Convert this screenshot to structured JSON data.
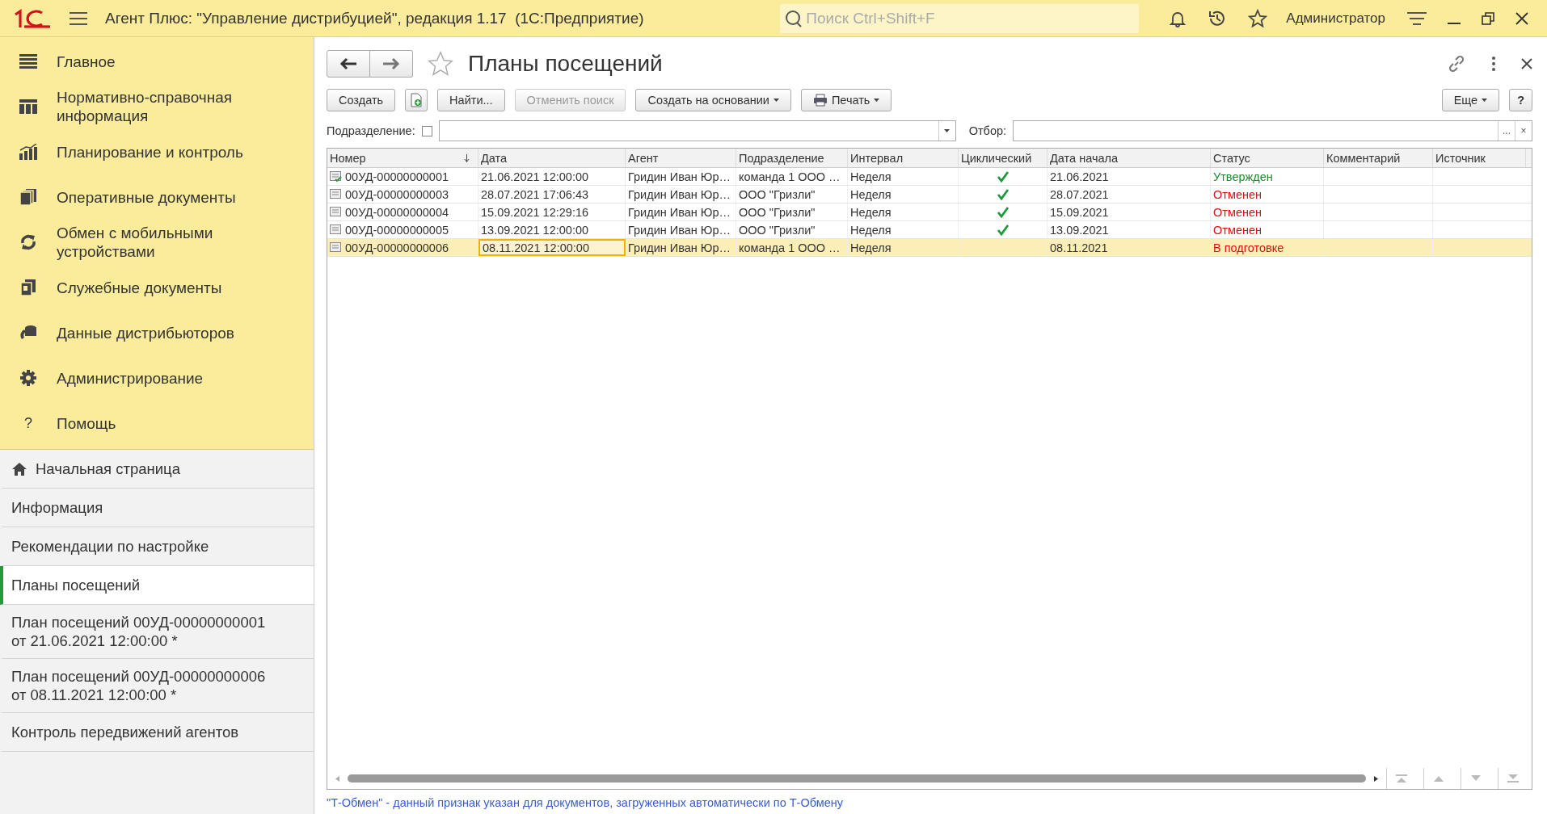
{
  "window": {
    "title": "Агент Плюс: \"Управление дистрибуцией\", редакция 1.17  (1С:Предприятие)",
    "search": {
      "placeholder": "Поиск Ctrl+Shift+F"
    },
    "user": "Администратор"
  },
  "sections": [
    {
      "label": "Главное"
    },
    {
      "label": "Нормативно-справочная информация"
    },
    {
      "label": "Планирование и контроль"
    },
    {
      "label": "Оперативные документы"
    },
    {
      "label": "Обмен с мобильными устройствами"
    },
    {
      "label": "Служебные документы"
    },
    {
      "label": "Данные дистрибьюторов"
    },
    {
      "label": "Администрирование"
    },
    {
      "label": "Помощь",
      "glyph": "?"
    }
  ],
  "open_windows": [
    {
      "label": "Начальная страница",
      "kind": "home",
      "selected": false
    },
    {
      "label": "Информация",
      "kind": "page",
      "selected": false
    },
    {
      "label": "Рекомендации по настройке",
      "kind": "page",
      "selected": false
    },
    {
      "label": "Планы посещений",
      "kind": "page",
      "selected": true
    },
    {
      "label": "План посещений 00УД-00000000001 от 21.06.2021 12:00:00 *",
      "kind": "page",
      "selected": false
    },
    {
      "label": "План посещений 00УД-00000000006 от 08.11.2021 12:00:00 *",
      "kind": "page",
      "selected": false
    },
    {
      "label": "Контроль передвижений агентов",
      "kind": "page",
      "selected": false
    }
  ],
  "form": {
    "title": "Планы посещений",
    "favorite": false,
    "toolbar": [
      {
        "label": "Создать",
        "kind": "button",
        "disabled": false
      },
      {
        "kind": "copy",
        "disabled": false
      },
      {
        "label": "Найти...",
        "kind": "button",
        "disabled": false
      },
      {
        "label": "Отменить поиск",
        "kind": "button",
        "disabled": true
      },
      {
        "label": "Создать на основании",
        "kind": "dropdown",
        "disabled": false
      },
      {
        "label": "Печать",
        "kind": "print",
        "disabled": false
      }
    ],
    "more": "Еще",
    "help": "?",
    "filter": {
      "department_label": "Подразделение:",
      "department_checked": false,
      "selection_label": "Отбор:",
      "selection_more": "...",
      "selection_clear": "×"
    },
    "table": {
      "columns": [
        "Номер",
        "Дата",
        "Агент",
        "Подразделение",
        "Интервал",
        "Циклический",
        "Дата начала",
        "Статус",
        "Комментарий",
        "Источник"
      ],
      "rows": [
        {
          "number": "00УД-00000000001",
          "date": "21.06.2021 12:00:00",
          "agent": "Гридин Иван Юр…",
          "department": "команда 1 ООО …",
          "interval": "Неделя",
          "cyclic": true,
          "start": "21.06.2021",
          "status": "Утвержден",
          "color": "#1d8a2e",
          "posted": true,
          "selected": false
        },
        {
          "number": "00УД-00000000003",
          "date": "28.07.2021 17:06:43",
          "agent": "Гридин Иван Юр…",
          "department": "ООО \"Гризли\"",
          "interval": "Неделя",
          "cyclic": true,
          "start": "28.07.2021",
          "status": "Отменен",
          "color": "#e01010",
          "posted": false,
          "selected": false
        },
        {
          "number": "00УД-00000000004",
          "date": "15.09.2021 12:29:16",
          "agent": "Гридин Иван Юр…",
          "department": "ООО \"Гризли\"",
          "interval": "Неделя",
          "cyclic": true,
          "start": "15.09.2021",
          "status": "Отменен",
          "color": "#e01010",
          "posted": false,
          "selected": false
        },
        {
          "number": "00УД-00000000005",
          "date": "13.09.2021 12:00:00",
          "agent": "Гридин Иван Юр…",
          "department": "ООО \"Гризли\"",
          "interval": "Неделя",
          "cyclic": true,
          "start": "13.09.2021",
          "status": "Отменен",
          "color": "#e01010",
          "posted": false,
          "selected": false
        },
        {
          "number": "00УД-00000000006",
          "date": "08.11.2021 12:00:00",
          "agent": "Гридин Иван Юр…",
          "department": "команда 1 ООО …",
          "interval": "Неделя",
          "cyclic": false,
          "start": "08.11.2021",
          "status": "В подготовке",
          "color": "#e01010",
          "posted": false,
          "selected": true
        }
      ]
    },
    "footnote": "\"Т-Обмен\" - данный признак указан для документов, загруженных автоматически по Т-Обмену"
  }
}
